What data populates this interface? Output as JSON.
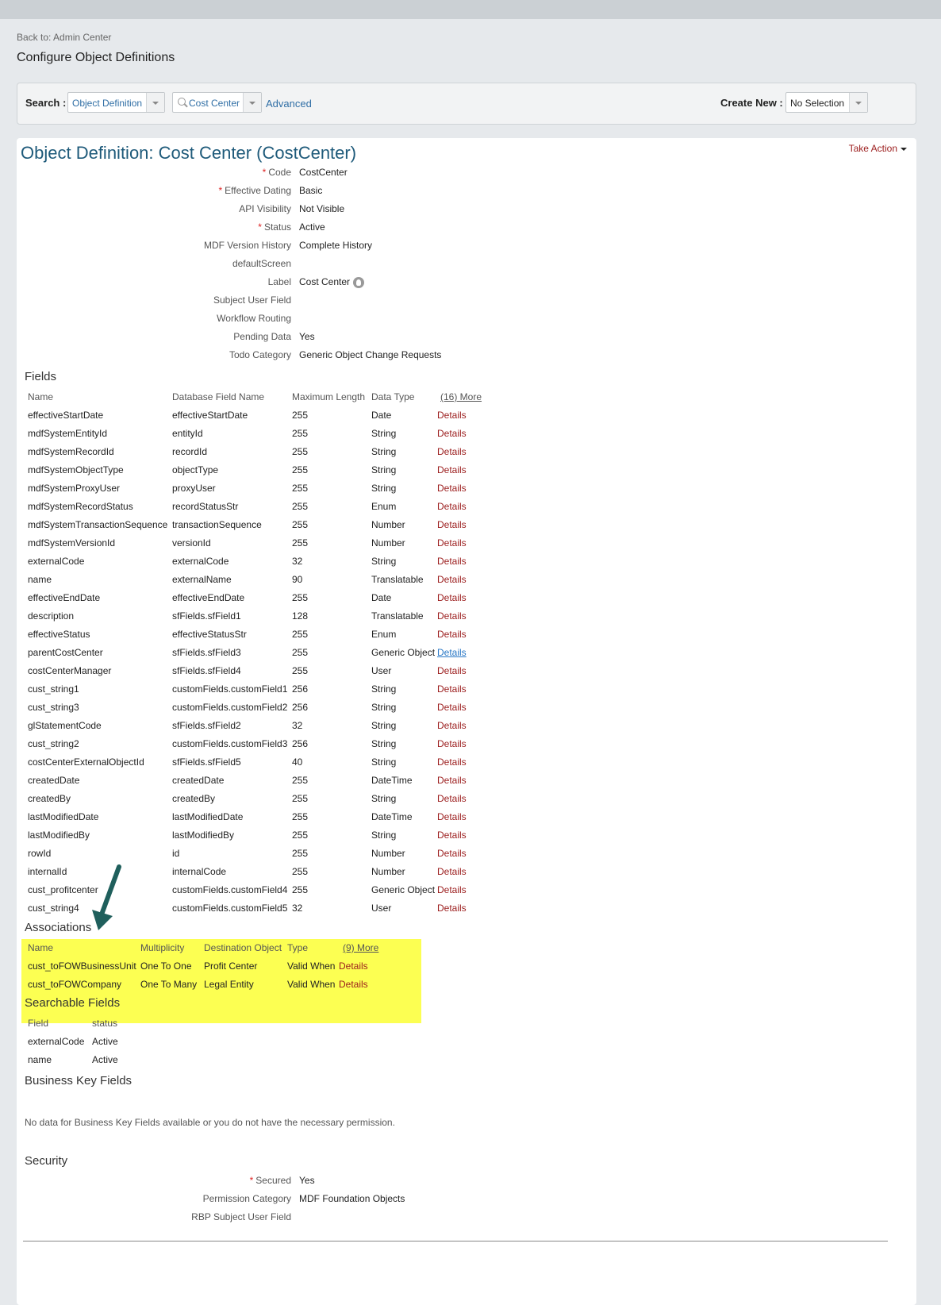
{
  "nav": {
    "back": "Back to: Admin Center",
    "page_title": "Configure Object Definitions"
  },
  "search": {
    "label": "Search :",
    "type_value": "Object Definition",
    "object_value": "Cost Center",
    "advanced": "Advanced",
    "create_label": "Create New :",
    "create_value": "No Selection"
  },
  "object": {
    "title": "Object Definition: Cost Center (CostCenter)",
    "take_action": "Take Action",
    "properties": [
      {
        "label": "Code",
        "required": true,
        "value": "CostCenter"
      },
      {
        "label": "Effective Dating",
        "required": true,
        "value": "Basic"
      },
      {
        "label": "API Visibility",
        "required": false,
        "value": "Not Visible"
      },
      {
        "label": "Status",
        "required": true,
        "value": "Active"
      },
      {
        "label": "MDF Version History",
        "required": false,
        "value": "Complete History"
      },
      {
        "label": "defaultScreen",
        "required": false,
        "value": ""
      },
      {
        "label": "Label",
        "required": false,
        "value": "Cost Center"
      },
      {
        "label": "Subject User Field",
        "required": false,
        "value": ""
      },
      {
        "label": "Workflow Routing",
        "required": false,
        "value": ""
      },
      {
        "label": "Pending Data",
        "required": false,
        "value": "Yes"
      },
      {
        "label": "Todo Category",
        "required": false,
        "value": "Generic Object Change Requests"
      }
    ]
  },
  "fields": {
    "title": "Fields",
    "headers": [
      "Name",
      "Database Field Name",
      "Maximum Length",
      "Data Type"
    ],
    "more": "(16) More",
    "details_label": "Details",
    "rows": [
      [
        "effectiveStartDate",
        "effectiveStartDate",
        "255",
        "Date"
      ],
      [
        "mdfSystemEntityId",
        "entityId",
        "255",
        "String"
      ],
      [
        "mdfSystemRecordId",
        "recordId",
        "255",
        "String"
      ],
      [
        "mdfSystemObjectType",
        "objectType",
        "255",
        "String"
      ],
      [
        "mdfSystemProxyUser",
        "proxyUser",
        "255",
        "String"
      ],
      [
        "mdfSystemRecordStatus",
        "recordStatusStr",
        "255",
        "Enum"
      ],
      [
        "mdfSystemTransactionSequence",
        "transactionSequence",
        "255",
        "Number"
      ],
      [
        "mdfSystemVersionId",
        "versionId",
        "255",
        "Number"
      ],
      [
        "externalCode",
        "externalCode",
        "32",
        "String"
      ],
      [
        "name",
        "externalName",
        "90",
        "Translatable"
      ],
      [
        "effectiveEndDate",
        "effectiveEndDate",
        "255",
        "Date"
      ],
      [
        "description",
        "sfFields.sfField1",
        "128",
        "Translatable"
      ],
      [
        "effectiveStatus",
        "effectiveStatusStr",
        "255",
        "Enum"
      ],
      [
        "parentCostCenter",
        "sfFields.sfField3",
        "255",
        "Generic Object"
      ],
      [
        "costCenterManager",
        "sfFields.sfField4",
        "255",
        "User"
      ],
      [
        "cust_string1",
        "customFields.customField1",
        "256",
        "String"
      ],
      [
        "cust_string3",
        "customFields.customField2",
        "256",
        "String"
      ],
      [
        "glStatementCode",
        "sfFields.sfField2",
        "32",
        "String"
      ],
      [
        "cust_string2",
        "customFields.customField3",
        "256",
        "String"
      ],
      [
        "costCenterExternalObjectId",
        "sfFields.sfField5",
        "40",
        "String"
      ],
      [
        "createdDate",
        "createdDate",
        "255",
        "DateTime"
      ],
      [
        "createdBy",
        "createdBy",
        "255",
        "String"
      ],
      [
        "lastModifiedDate",
        "lastModifiedDate",
        "255",
        "DateTime"
      ],
      [
        "lastModifiedBy",
        "lastModifiedBy",
        "255",
        "String"
      ],
      [
        "rowId",
        "id",
        "255",
        "Number"
      ],
      [
        "internalId",
        "internalCode",
        "255",
        "Number"
      ],
      [
        "cust_profitcenter",
        "customFields.customField4",
        "255",
        "Generic Object"
      ],
      [
        "cust_string4",
        "customFields.customField5",
        "32",
        "User"
      ]
    ]
  },
  "associations": {
    "title": "Associations",
    "headers": [
      "Name",
      "Multiplicity",
      "Destination Object",
      "Type"
    ],
    "more": "(9) More",
    "details_label": "Details",
    "rows": [
      [
        "cust_toFOWBusinessUnit",
        "One To One",
        "Profit Center",
        "Valid When"
      ],
      [
        "cust_toFOWCompany",
        "One To Many",
        "Legal Entity",
        "Valid When"
      ]
    ]
  },
  "searchable": {
    "title": "Searchable Fields",
    "headers": [
      "Field",
      "status"
    ],
    "rows": [
      [
        "externalCode",
        "Active"
      ],
      [
        "name",
        "Active"
      ]
    ]
  },
  "business_key": {
    "title": "Business Key Fields",
    "message": "No data for Business Key Fields available or you do not have the necessary permission."
  },
  "security": {
    "title": "Security",
    "properties": [
      {
        "label": "Secured",
        "required": true,
        "value": "Yes"
      },
      {
        "label": "Permission Category",
        "required": false,
        "value": "MDF Foundation Objects"
      },
      {
        "label": "RBP Subject User Field",
        "required": false,
        "value": ""
      }
    ]
  },
  "colors": {
    "link_red": "#9b1c1c",
    "link_blue": "#2a78c6",
    "title_blue": "#1e5a7a",
    "highlight": "#fcff52",
    "arrow": "#1f5f5c"
  }
}
